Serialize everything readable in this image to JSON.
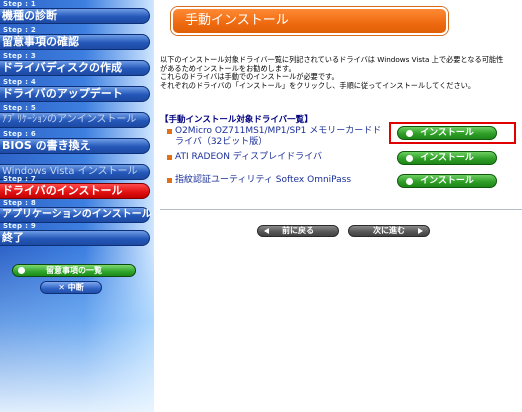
{
  "sidebar": {
    "steps": [
      {
        "step": "Step : 1",
        "label": "機種の診断"
      },
      {
        "step": "Step : 2",
        "label": "留意事項の確認"
      },
      {
        "step": "Step : 3",
        "label": "ドライバディスクの作成"
      },
      {
        "step": "Step : 4",
        "label": "ドライバのアップデート"
      },
      {
        "step": "Step : 5",
        "label": "ｱﾌﾟﾘｹｰｼｮﾝのアンインストール"
      },
      {
        "step": "Step : 6",
        "label": "BIOS の書き換え"
      },
      {
        "step": "",
        "label": "Windows Vista インストール"
      },
      {
        "step": "Step : 7",
        "label": "ドライバのインストール"
      },
      {
        "step": "Step : 8",
        "label": "アプリケーションのインストール"
      },
      {
        "step": "Step : 9",
        "label": "終了"
      }
    ],
    "notes_button": "留意事項の一覧",
    "close_button": "✕ 中断"
  },
  "main": {
    "title": "手動インストール",
    "intro_lines": [
      "以下のインストール対象ドライバ一覧に列記されているドライバは Windows Vista 上で必要となる可能性",
      "があるためインストールをお勧めします。",
      "これらのドライバは手動でのインストールが必要です。",
      "それぞれのドライバの「インストール」をクリックし、手順に従ってインストールしてください。"
    ],
    "section_heading": "手動インストール対象ドライバ一覧",
    "drivers": [
      {
        "name": "O2Micro OZ711MS1/MP1/SP1 メモリーカードドライバ（32ビット版）",
        "button": "インストール"
      },
      {
        "name": "ATI RADEON ディスプレイドライバ",
        "button": "インストール"
      },
      {
        "name": "指紋認証ユーティリティ Softex OmniPass",
        "button": "インストール"
      }
    ],
    "back_button": "前に戻る",
    "next_button": "次に進む"
  },
  "colors": {
    "accent_orange": "#ee6a10",
    "sidebar_blue": "#2457b8",
    "active_red": "#e01010",
    "install_green": "#2e9f27",
    "highlight_red": "#e00000",
    "link_blue": "#1a2f9a"
  }
}
